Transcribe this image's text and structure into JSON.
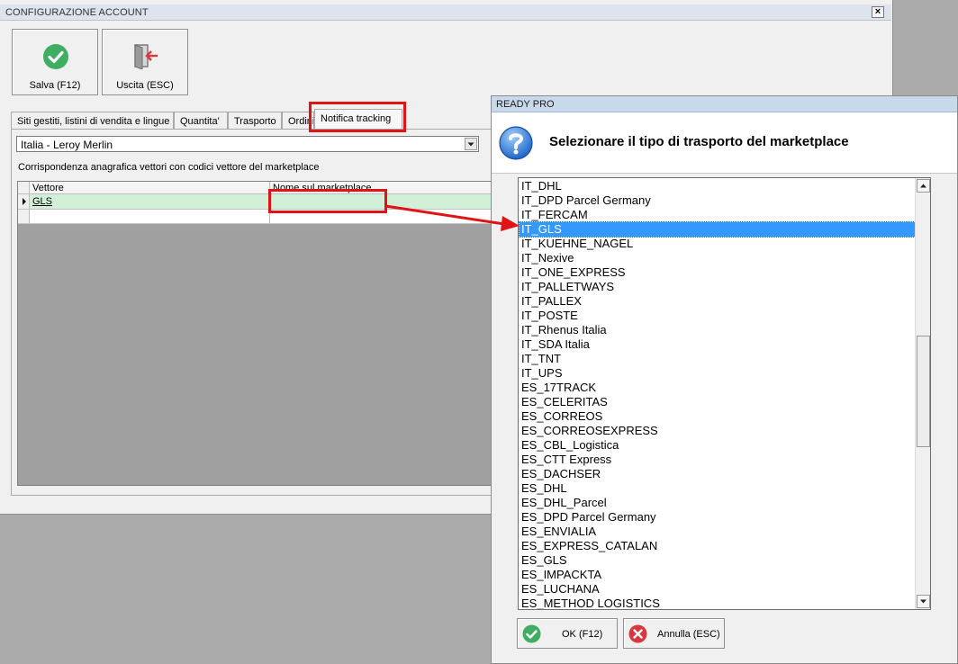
{
  "main_window": {
    "title": "CONFIGURAZIONE ACCOUNT",
    "close_glyph": "×",
    "toolbar": {
      "save_label": "Salva (F12)",
      "exit_label": "Uscita (ESC)"
    },
    "tabs": [
      {
        "label": "Siti gestiti, listini di vendita e lingue"
      },
      {
        "label": "Quantita'"
      },
      {
        "label": "Trasporto"
      },
      {
        "label": "Ordini"
      },
      {
        "label": "Notifica tracking",
        "active": true
      }
    ],
    "site_select_value": "Italia - Leroy Merlin",
    "grid_caption": "Corrispondenza anagrafica vettori con codici vettore del marketplace",
    "grid": {
      "columns": [
        "Vettore",
        "Nome sul marketplace"
      ],
      "rows": [
        {
          "carrier": "GLS",
          "marketplace_name": ""
        }
      ]
    }
  },
  "dialog": {
    "title": "READY PRO",
    "question": "Selezionare il tipo di trasporto del marketplace",
    "icon": "question-icon",
    "items": [
      "IT_DHL",
      "IT_DPD Parcel Germany",
      "IT_FERCAM",
      "IT_GLS",
      "IT_KUEHNE_NAGEL",
      "IT_Nexive",
      "IT_ONE_EXPRESS",
      "IT_PALLETWAYS",
      "IT_PALLEX",
      "IT_POSTE",
      "IT_Rhenus Italia",
      "IT_SDA Italia",
      "IT_TNT",
      "IT_UPS",
      "ES_17TRACK",
      "ES_CELERITAS",
      "ES_CORREOS",
      "ES_CORREOSEXPRESS",
      "ES_CBL_Logistica",
      "ES_CTT Express",
      "ES_DACHSER",
      "ES_DHL",
      "ES_DHL_Parcel",
      "ES_DPD Parcel Germany",
      "ES_ENVIALIA",
      "ES_EXPRESS_CATALAN",
      "ES_GLS",
      "ES_IMPACKTA",
      "ES_LUCHANA",
      "ES_METHOD LOGISTICS"
    ],
    "selected_item": "IT_GLS",
    "ok_label": "OK (F12)",
    "cancel_label": "Annulla (ESC)"
  },
  "colors": {
    "highlight": "#e01414",
    "selection": "#3399ff",
    "ok_green": "#3fae62",
    "cancel_red": "#d9363e",
    "grid_row": "#d1f0d7"
  }
}
